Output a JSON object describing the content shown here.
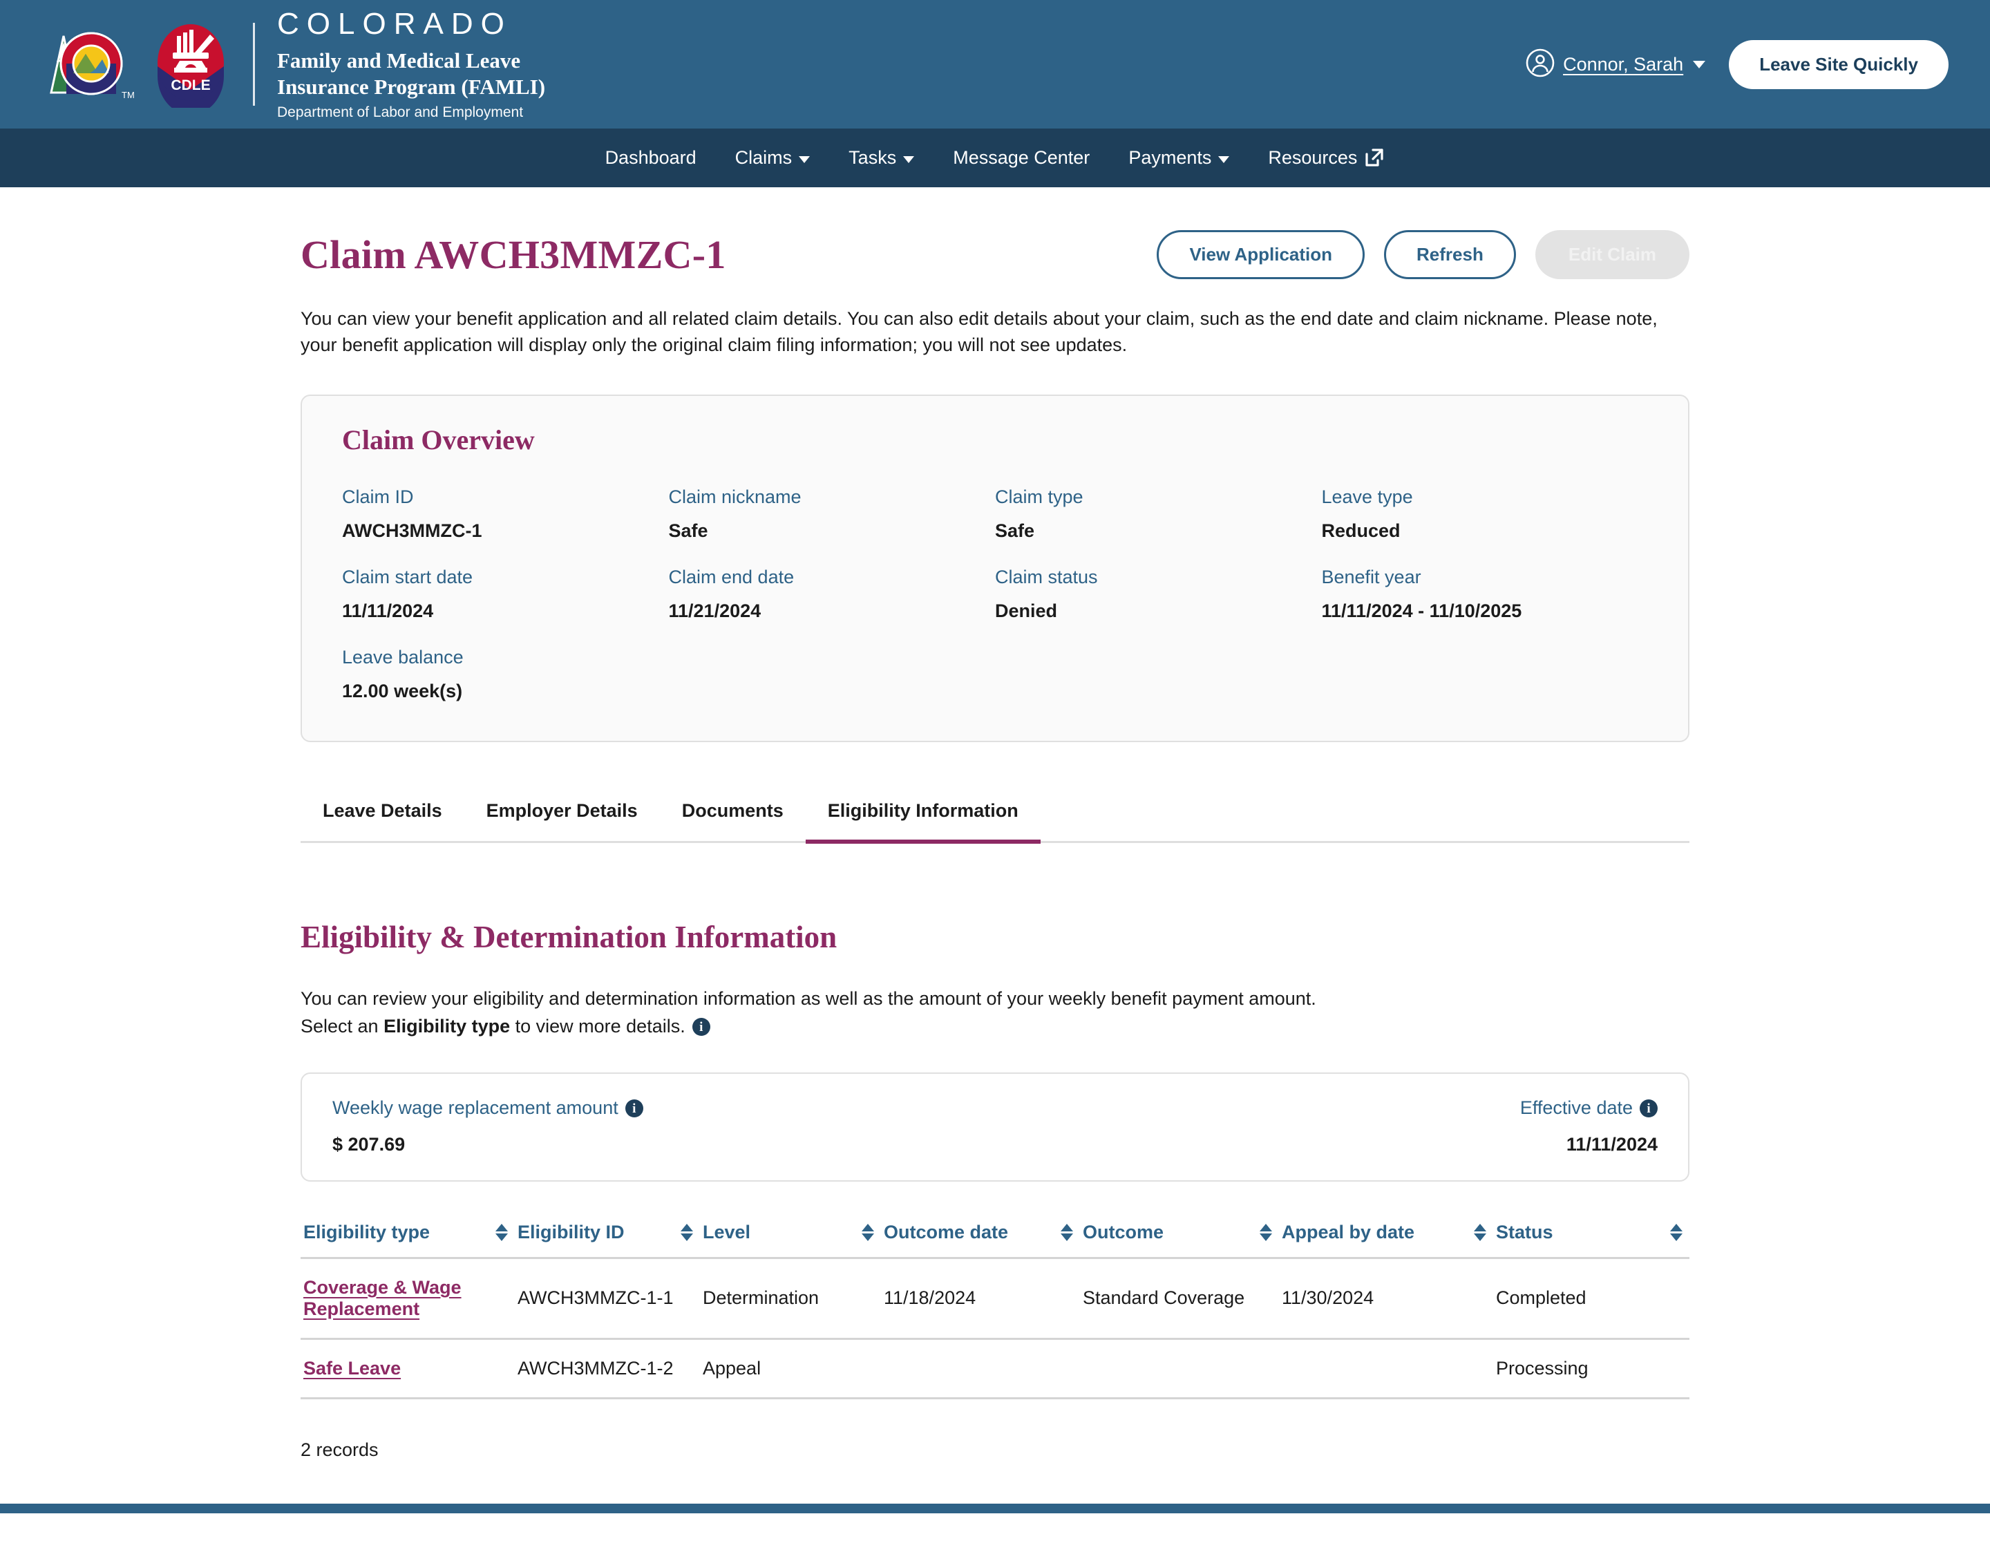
{
  "header": {
    "logo_alt": "colorado-cdle-logo",
    "brand_state": "COLORADO",
    "brand_program_line1": "Family and Medical Leave",
    "brand_program_line2": "Insurance Program (FAMLI)",
    "brand_dept": "Department of Labor and Employment",
    "user_name": "Connor, Sarah",
    "leave_site_button": "Leave Site Quickly"
  },
  "nav": {
    "items": [
      {
        "label": "Dashboard",
        "has_caret": false,
        "external": false
      },
      {
        "label": "Claims",
        "has_caret": true,
        "external": false
      },
      {
        "label": "Tasks",
        "has_caret": true,
        "external": false
      },
      {
        "label": "Message Center",
        "has_caret": false,
        "external": false
      },
      {
        "label": "Payments",
        "has_caret": true,
        "external": false
      },
      {
        "label": "Resources",
        "has_caret": false,
        "external": true
      }
    ]
  },
  "page": {
    "title": "Claim AWCH3MMZC-1",
    "intro": "You can view your benefit application and all related claim details. You can also edit details about your claim, such as the end date and claim nickname. Please note, your benefit application will display only the original claim filing information; you will not see updates.",
    "actions": {
      "view_application": "View Application",
      "refresh": "Refresh",
      "edit_claim": "Edit Claim"
    }
  },
  "overview": {
    "title": "Claim Overview",
    "fields": [
      {
        "label": "Claim ID",
        "value": "AWCH3MMZC-1"
      },
      {
        "label": "Claim nickname",
        "value": "Safe"
      },
      {
        "label": "Claim type",
        "value": "Safe"
      },
      {
        "label": "Leave type",
        "value": "Reduced"
      },
      {
        "label": "Claim start date",
        "value": "11/11/2024"
      },
      {
        "label": "Claim end date",
        "value": "11/21/2024"
      },
      {
        "label": "Claim status",
        "value": "Denied"
      },
      {
        "label": "Benefit year",
        "value": "11/11/2024 - 11/10/2025"
      },
      {
        "label": "Leave balance",
        "value": "12.00 week(s)"
      }
    ]
  },
  "tabs": [
    {
      "label": "Leave Details",
      "active": false
    },
    {
      "label": "Employer Details",
      "active": false
    },
    {
      "label": "Documents",
      "active": false
    },
    {
      "label": "Eligibility Information",
      "active": true
    }
  ],
  "eligibility": {
    "section_title": "Eligibility & Determination Information",
    "desc_line1": "You can review your eligibility and determination information as well as the amount of your weekly benefit payment amount.",
    "desc_line2_prefix": "Select an ",
    "desc_line2_bold": "Eligibility type",
    "desc_line2_suffix": " to view more details.",
    "info_icon_glyph": "i",
    "wage_card": {
      "amount_label": "Weekly wage replacement amount",
      "amount_value": "$ 207.69",
      "effective_label": "Effective date",
      "effective_value": "11/11/2024"
    },
    "table": {
      "columns": [
        "Eligibility type",
        "Eligibility ID",
        "Level",
        "Outcome date",
        "Outcome",
        "Appeal by date",
        "Status"
      ],
      "rows": [
        {
          "eligibility_type": "Coverage & Wage Replacement",
          "eligibility_id": "AWCH3MMZC-1-1",
          "level": "Determination",
          "outcome_date": "11/18/2024",
          "outcome": "Standard Coverage",
          "appeal_by_date": "11/30/2024",
          "status": "Completed"
        },
        {
          "eligibility_type": "Safe Leave",
          "eligibility_id": "AWCH3MMZC-1-2",
          "level": "Appeal",
          "outcome_date": "",
          "outcome": "",
          "appeal_by_date": "",
          "status": "Processing"
        }
      ],
      "record_count": "2 records"
    }
  },
  "colors": {
    "header_blue": "#2e6287",
    "nav_blue": "#1e3f5a",
    "accent_magenta": "#8d2a64",
    "link_blue": "#2e6287",
    "card_bg": "#fafafa"
  }
}
